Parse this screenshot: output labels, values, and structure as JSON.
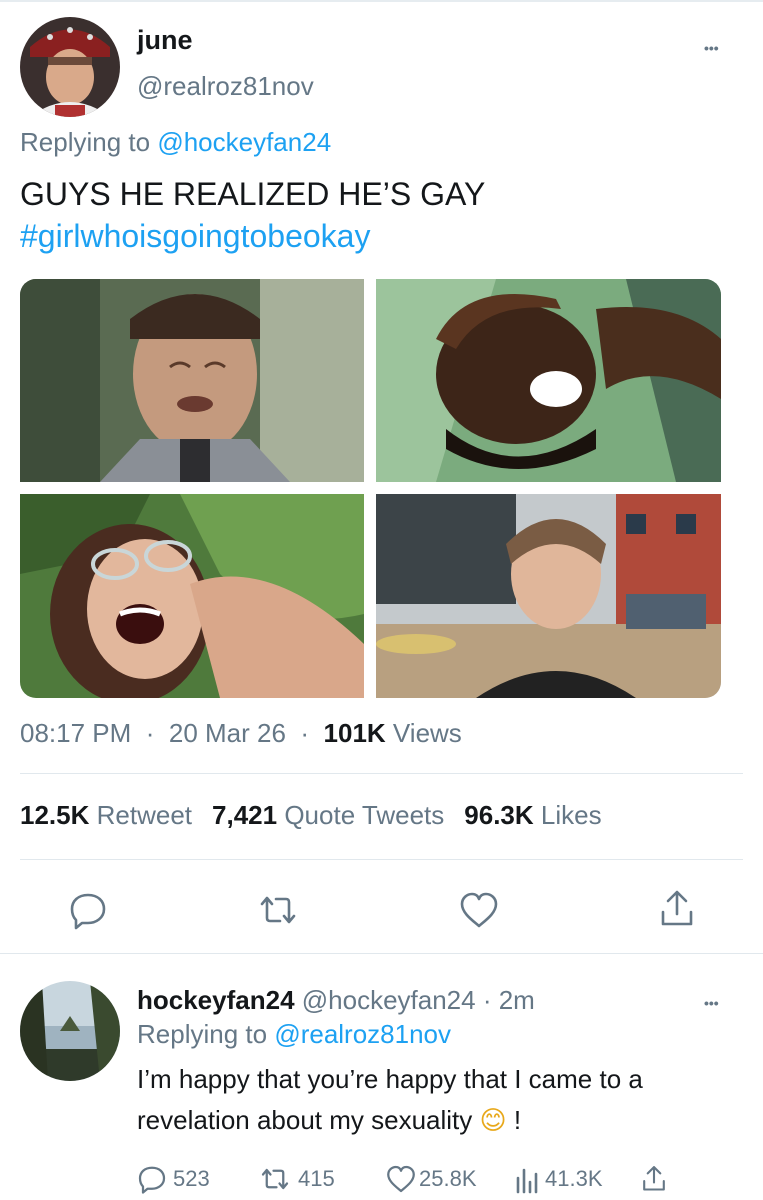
{
  "tweet": {
    "display_name": "june",
    "handle": "@realroz81nov",
    "replying_prefix": "Replying to",
    "replying_handle": "@hockeyfan24",
    "text": "GUYS HE REALIZED HE’S GAY",
    "hashtag": "#girlwhoisgoingtobeokay",
    "time": "08:17 PM",
    "date": "20 Mar 26",
    "views_count": "101K",
    "views_label": "Views",
    "retweets_count": "12.5K",
    "retweets_label": "Retweet",
    "quotes_count": "7,421",
    "quotes_label": "Quote Tweets",
    "likes_count": "96.3K",
    "likes_label": "Likes",
    "more_label": "•••",
    "icons": [
      "reply-icon",
      "retweet-icon",
      "like-icon",
      "share-icon"
    ]
  },
  "reply": {
    "display_name": "hockeyfan24",
    "handle": "@hockeyfan24",
    "time_ago": "2m",
    "replying_prefix": "Replying to",
    "replying_handle": "@realroz81nov",
    "text_line1": "I’m happy that you’re happy that I came to a",
    "text_line2": "revelation about my sexuality",
    "text_suffix": "!",
    "emoji": "😊",
    "reply_count": "523",
    "retweet_count": "415",
    "like_count": "25.8K",
    "views_count": "41.3K",
    "more_label": "•••"
  },
  "colors": {
    "accent": "#1da1f2",
    "muted": "#657786",
    "text": "#14171a",
    "divider": "#e1e8ed"
  }
}
